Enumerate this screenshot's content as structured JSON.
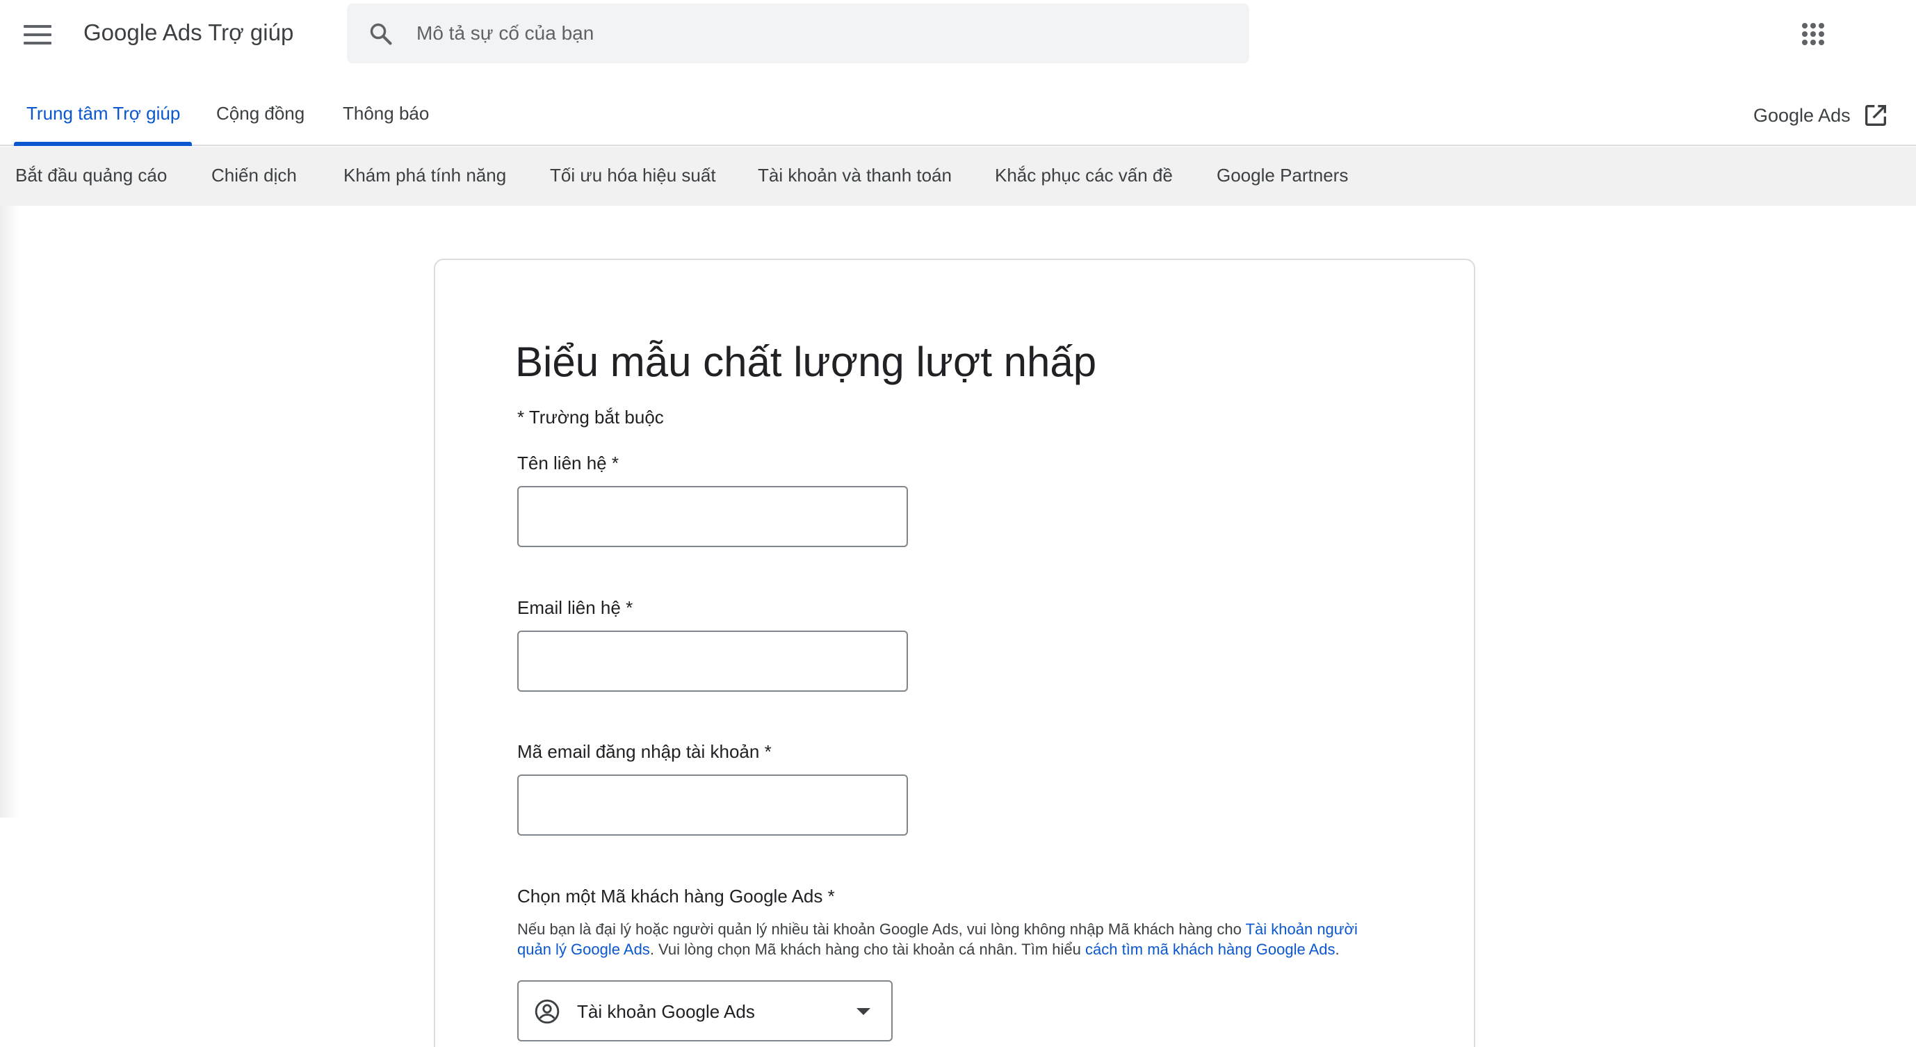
{
  "header": {
    "product_title": "Google Ads Trợ giúp",
    "search": {
      "placeholder": "Mô tả sự cố của bạn",
      "value": ""
    }
  },
  "tabs": {
    "items": [
      {
        "label": "Trung tâm Trợ giúp",
        "active": true
      },
      {
        "label": "Cộng đồng",
        "active": false
      },
      {
        "label": "Thông báo",
        "active": false
      }
    ],
    "external_link": "Google Ads"
  },
  "categories": [
    "Bắt đầu quảng cáo",
    "Chiến dịch",
    "Khám phá tính năng",
    "Tối ưu hóa hiệu suất",
    "Tài khoản và thanh toán",
    "Khắc phục các vấn đề",
    "Google Partners"
  ],
  "form": {
    "title": "Biểu mẫu chất lượng lượt nhấp",
    "required_note": "* Trường bắt buộc",
    "fields": {
      "contact_name": {
        "label": "Tên liên hệ *",
        "value": ""
      },
      "contact_email": {
        "label": "Email liên hệ *",
        "value": ""
      },
      "login_email": {
        "label": "Mã email đăng nhập tài khoản *",
        "value": ""
      }
    },
    "customer_id": {
      "label": "Chọn một Mã khách hàng Google Ads *",
      "help_part1": "Nếu bạn là đại lý hoặc người quản lý nhiều tài khoản Google Ads, vui lòng không nhập Mã khách hàng cho ",
      "help_link1": "Tài khoản người quản lý Google Ads",
      "help_part2": ". Vui lòng chọn Mã khách hàng cho tài khoản cá nhân. Tìm hiểu ",
      "help_link2": "cách tìm mã khách hàng Google Ads",
      "help_part3": ".",
      "selected": "Tài khoản Google Ads"
    }
  },
  "colors": {
    "accent_blue": "#0b57d0",
    "category_bar_bg": "#f1f1f1",
    "search_bg": "#f1f3f4"
  },
  "icons": {
    "menu": "hamburger-menu-icon",
    "search": "search-icon",
    "apps": "apps-grid-icon",
    "external": "open-in-new-icon",
    "account": "account-circle-icon",
    "dropdown": "arrow-drop-down-icon"
  }
}
